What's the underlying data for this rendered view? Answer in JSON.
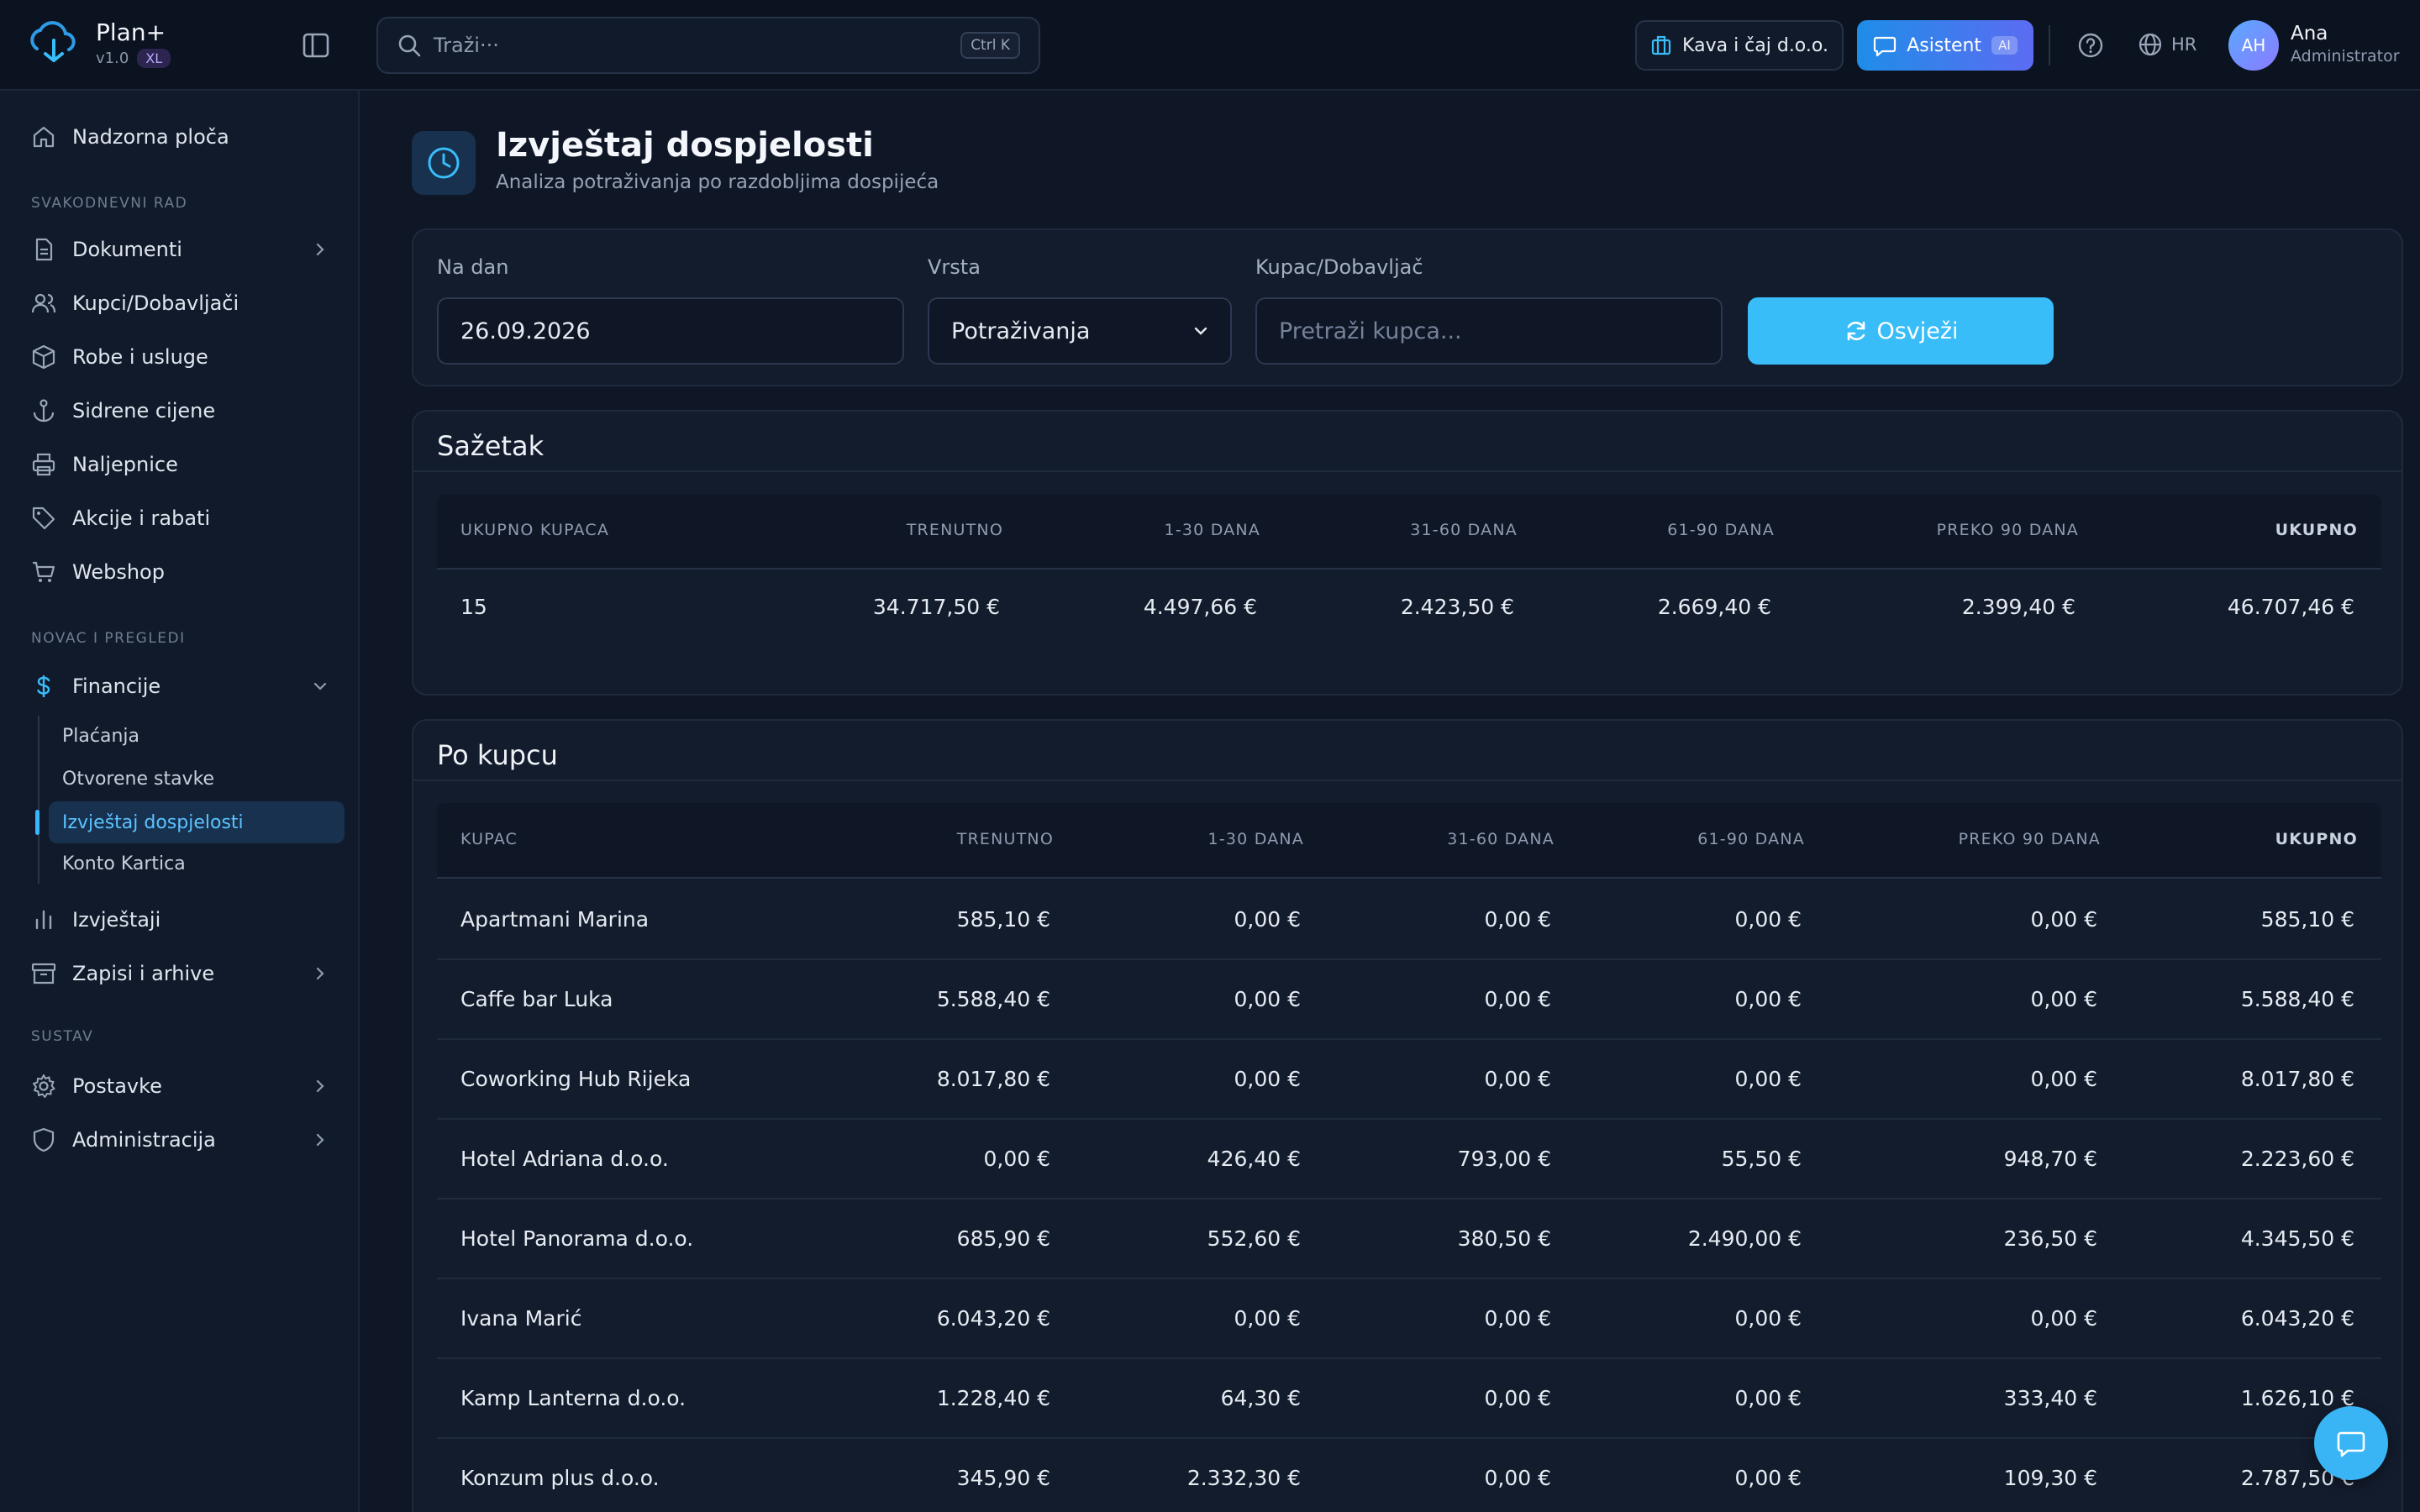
{
  "brand": {
    "name": "Plan+",
    "version": "v1.0",
    "badge": "XL"
  },
  "search": {
    "placeholder": "Traži···",
    "shortcut": "Ctrl K"
  },
  "header": {
    "company": "Kava i čaj d.o.o.",
    "assistant_label": "Asistent",
    "assistant_badge": "AI",
    "language": "HR",
    "user_initials": "AH",
    "user_name": "Ana",
    "user_role": "Administrator"
  },
  "sidebar": {
    "dashboard": "Nadzorna ploča",
    "section_daily": "SVAKODNEVNI RAD",
    "section_money": "NOVAC I PREGLEDI",
    "section_system": "SUSTAV",
    "items": {
      "documents": "Dokumenti",
      "partners": "Kupci/Dobavljači",
      "goods": "Robe i usluge",
      "anchor_prices": "Sidrene cijene",
      "labels": "Naljepnice",
      "promos": "Akcije i rabati",
      "webshop": "Webshop",
      "finance": "Financije",
      "reports": "Izvještaji",
      "records": "Zapisi i arhive",
      "settings": "Postavke",
      "admin": "Administracija"
    },
    "finance_sub": [
      "Plaćanja",
      "Otvorene stavke",
      "Izvještaj dospjelosti",
      "Konto Kartica"
    ]
  },
  "page": {
    "title": "Izvještaj dospjelosti",
    "subtitle": "Analiza potraživanja po razdobljima dospijeća"
  },
  "filters": {
    "date_label": "Na dan",
    "date_value": "26.09.2026",
    "type_label": "Vrsta",
    "type_value": "Potraživanja",
    "partner_label": "Kupac/Dobavljač",
    "partner_placeholder": "Pretraži kupca...",
    "refresh_label": "Osvježi"
  },
  "summary": {
    "title": "Sažetak",
    "headers": [
      "UKUPNO KUPACA",
      "TRENUTNO",
      "1-30 DANA",
      "31-60 DANA",
      "61-90 DANA",
      "PREKO 90 DANA",
      "UKUPNO"
    ],
    "values": [
      "15",
      "34.717,50 €",
      "4.497,66 €",
      "2.423,50 €",
      "2.669,40 €",
      "2.399,40 €",
      "46.707,46 €"
    ]
  },
  "by_customer": {
    "title": "Po kupcu",
    "headers": [
      "KUPAC",
      "TRENUTNO",
      "1-30 DANA",
      "31-60 DANA",
      "61-90 DANA",
      "PREKO 90 DANA",
      "UKUPNO"
    ],
    "rows": [
      [
        "Apartmani Marina",
        "585,10 €",
        "0,00 €",
        "0,00 €",
        "0,00 €",
        "0,00 €",
        "585,10 €"
      ],
      [
        "Caffe bar Luka",
        "5.588,40 €",
        "0,00 €",
        "0,00 €",
        "0,00 €",
        "0,00 €",
        "5.588,40 €"
      ],
      [
        "Coworking Hub Rijeka",
        "8.017,80 €",
        "0,00 €",
        "0,00 €",
        "0,00 €",
        "0,00 €",
        "8.017,80 €"
      ],
      [
        "Hotel Adriana d.o.o.",
        "0,00 €",
        "426,40 €",
        "793,00 €",
        "55,50 €",
        "948,70 €",
        "2.223,60 €"
      ],
      [
        "Hotel Panorama d.o.o.",
        "685,90 €",
        "552,60 €",
        "380,50 €",
        "2.490,00 €",
        "236,50 €",
        "4.345,50 €"
      ],
      [
        "Ivana Marić",
        "6.043,20 €",
        "0,00 €",
        "0,00 €",
        "0,00 €",
        "0,00 €",
        "6.043,20 €"
      ],
      [
        "Kamp Lanterna d.o.o.",
        "1.228,40 €",
        "64,30 €",
        "0,00 €",
        "0,00 €",
        "333,40 €",
        "1.626,10 €"
      ],
      [
        "Konzum plus d.o.o.",
        "345,90 €",
        "2.332,30 €",
        "0,00 €",
        "0,00 €",
        "109,30 €",
        "2.787,50 €"
      ]
    ]
  },
  "icons": {
    "logo": "cloud-sync-icon",
    "sidebar_toggle": "sidebar-toggle-icon",
    "search": "search-icon",
    "company": "building-icon",
    "assistant": "chat-icon",
    "help": "help-circle-icon",
    "language": "globe-icon",
    "page": "clock-icon",
    "refresh": "refresh-icon",
    "chat_fab": "chat-bubble-icon"
  },
  "colors": {
    "accent": "#38bdf8",
    "assistant_gradient_start": "#1f8de8",
    "assistant_gradient_end": "#5c6cf2",
    "background": "#0f1625",
    "sidebar": "#111a2a",
    "active_item": "#5cc3ff"
  }
}
